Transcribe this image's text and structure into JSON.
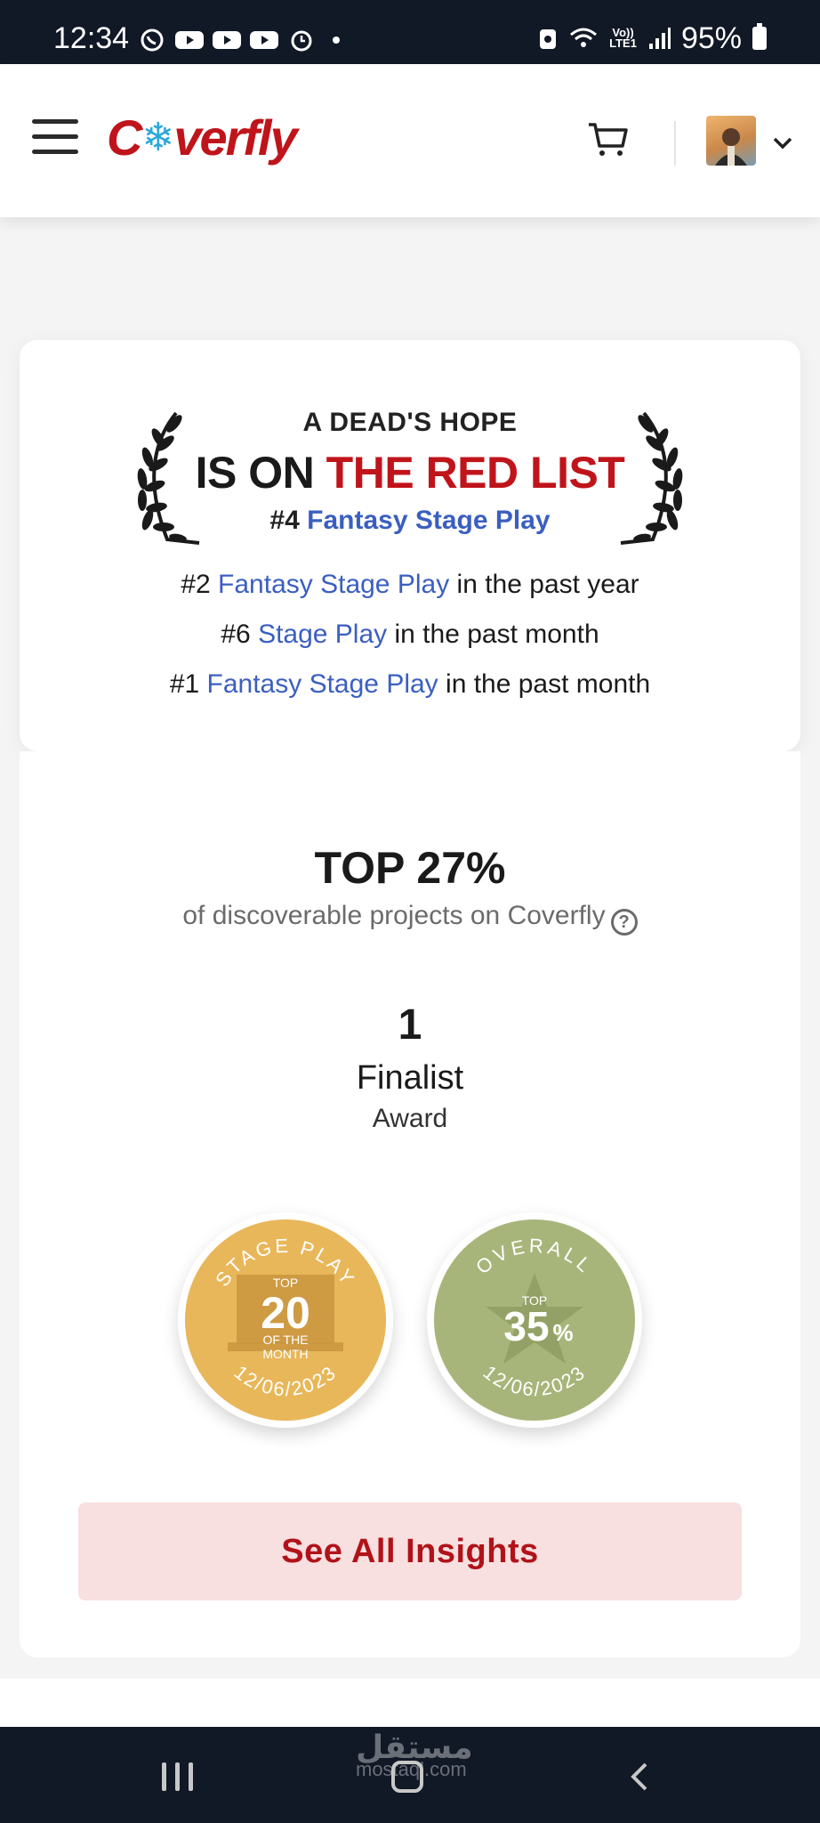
{
  "status_bar": {
    "time": "12:34",
    "battery": "95%",
    "network": "Vo))\nLTE1",
    "icons": [
      "whatsapp-icon",
      "youtube-icon",
      "youtube-icon",
      "youtube-icon",
      "alarm-icon",
      "battery-saver-icon",
      "wifi-icon",
      "signal-icon"
    ]
  },
  "header": {
    "logo_pre": "C",
    "logo_post": "verfly",
    "icons": [
      "menu-icon",
      "cart-icon",
      "chevron-down-icon"
    ]
  },
  "red_list": {
    "project_title": "A DEAD'S HOPE",
    "headline_prefix": "IS ON ",
    "headline_highlight": "THE RED LIST",
    "main_rank": "#4 ",
    "main_category": "Fantasy Stage Play",
    "rankings": [
      {
        "rank": "#2 ",
        "category": "Fantasy Stage Play",
        "period": " in the past year"
      },
      {
        "rank": "#6 ",
        "category": "Stage Play",
        "period": " in the past month"
      },
      {
        "rank": "#1 ",
        "category": "Fantasy Stage Play",
        "period": " in the past month"
      }
    ]
  },
  "stats": {
    "top_percent": "TOP 27%",
    "top_subtitle": "of discoverable projects on Coverfly",
    "award_count": "1",
    "award_type": "Finalist",
    "award_label": "Award"
  },
  "badges": [
    {
      "arc": "STAGE PLAY",
      "top": "TOP",
      "value": "20",
      "line1": "OF THE",
      "line2": "MONTH",
      "date": "12/06/2023",
      "color": "#e8b75a"
    },
    {
      "arc": "OVERALL",
      "top": "TOP",
      "value": "35",
      "unit": "%",
      "date": "12/06/2023",
      "color": "#a8b57a"
    }
  ],
  "button": {
    "label": "See All Insights"
  },
  "watermark": {
    "arabic": "مستقل",
    "latin": "mostaql.com"
  }
}
